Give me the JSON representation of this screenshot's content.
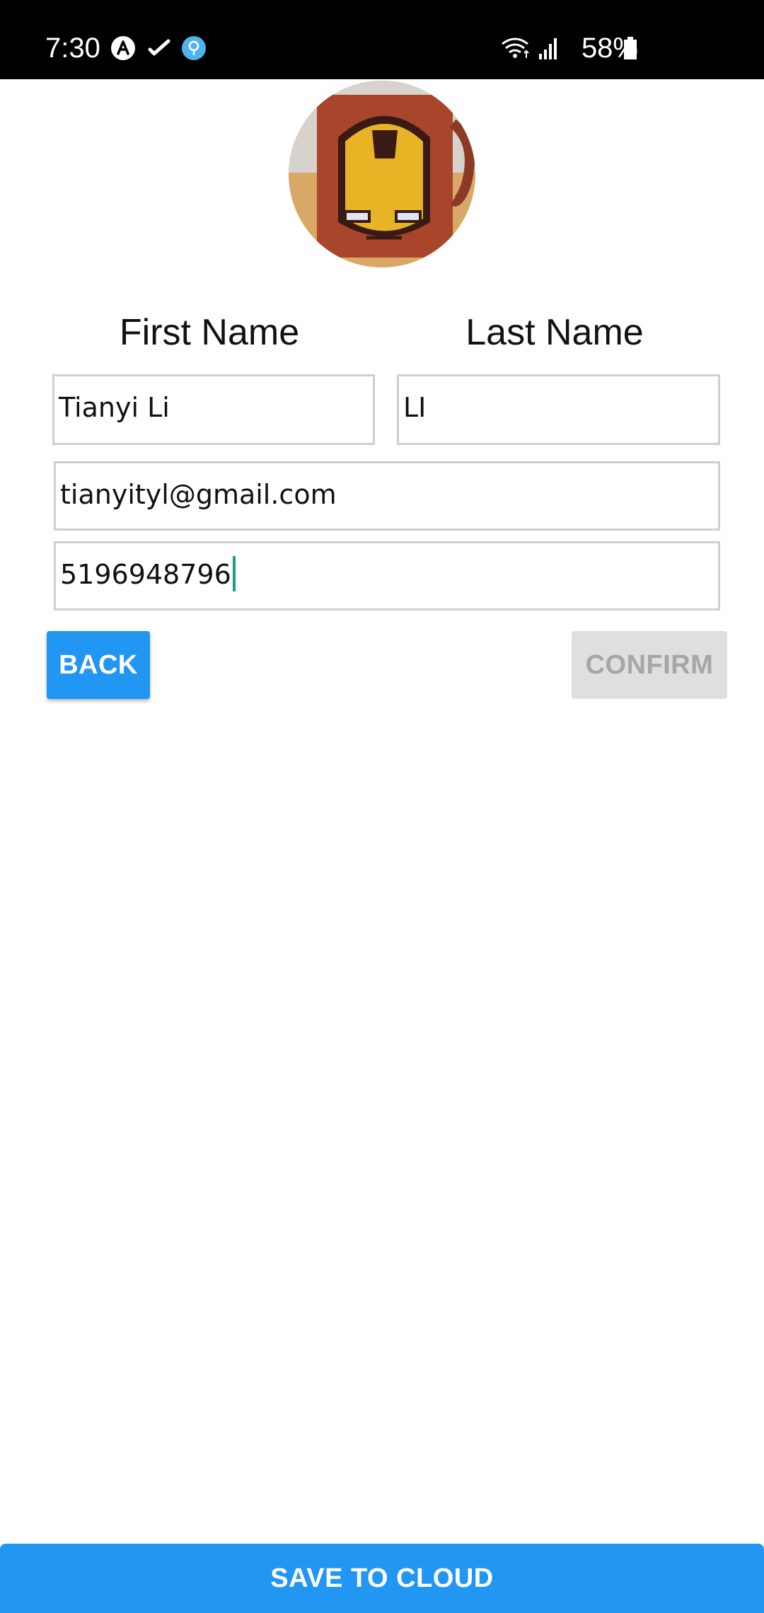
{
  "status_bar": {
    "time": "7:30",
    "battery": "58%",
    "icons": [
      "app-a-icon",
      "check-icon",
      "location-pin-icon",
      "wifi-icon",
      "signal-icon",
      "battery-icon"
    ]
  },
  "profile": {
    "avatar_description_icon": "avatar-photo"
  },
  "form": {
    "first_name_label": "First Name",
    "last_name_label": "Last Name",
    "first_name_value": "Tianyi Li",
    "last_name_value": "LI",
    "email_value": "tianyityl@gmail.com",
    "phone_value": "5196948796"
  },
  "buttons": {
    "back": "BACK",
    "confirm": "CONFIRM",
    "save": "SAVE TO CLOUD"
  },
  "colors": {
    "primary": "#2196f3",
    "disabled_bg": "#dfdfdf",
    "disabled_text": "#a6a6a6",
    "caret": "#1a9c8a"
  }
}
